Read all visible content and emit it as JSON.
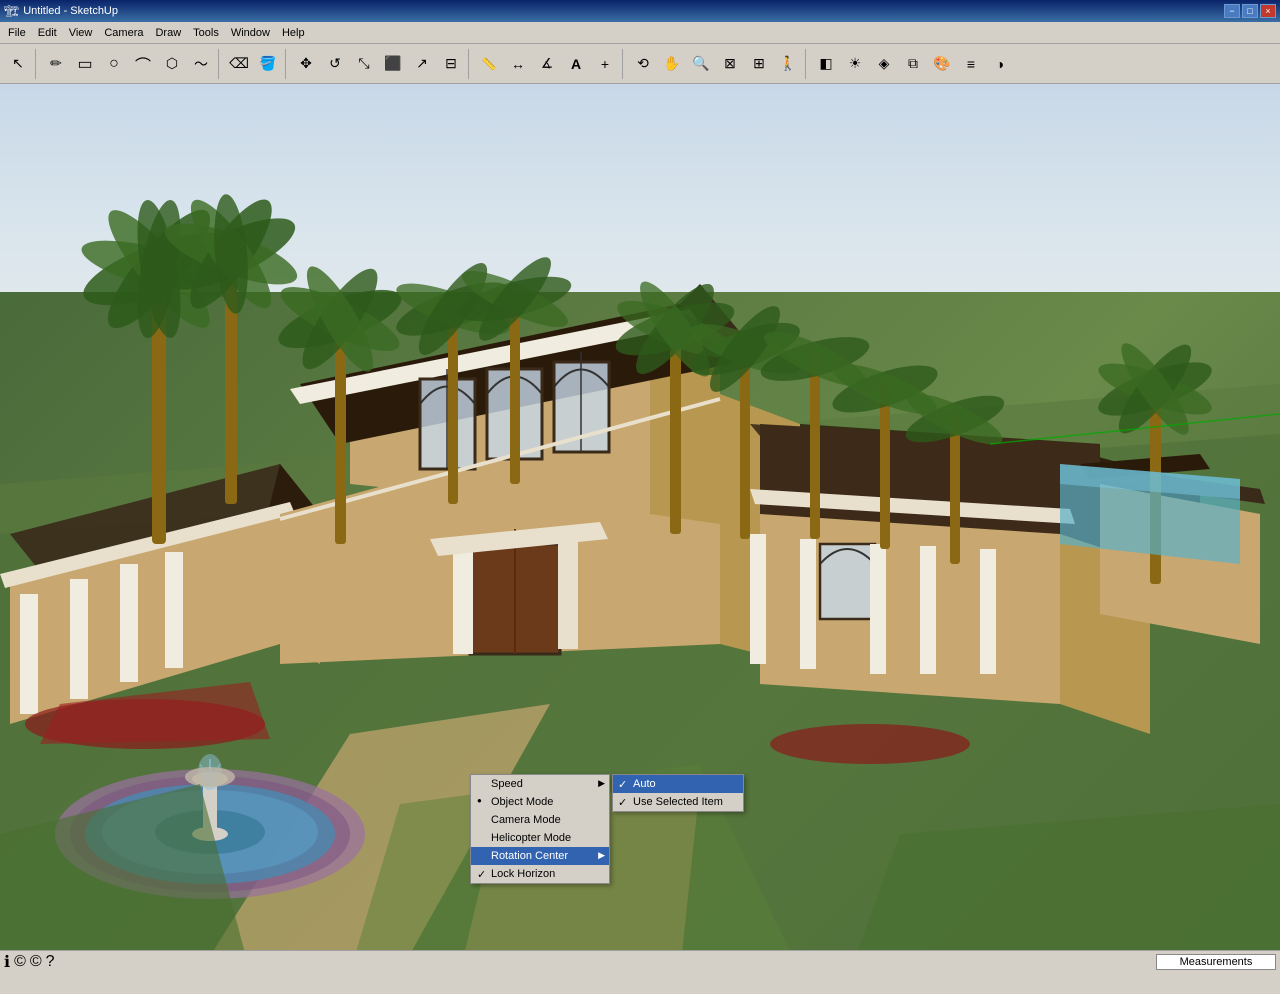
{
  "titlebar": {
    "title": "Untitled - SketchUp",
    "icon": "sketchup-icon",
    "controls": {
      "minimize": "−",
      "maximize": "□",
      "close": "×"
    }
  },
  "menubar": {
    "items": [
      "File",
      "Edit",
      "View",
      "Camera",
      "Draw",
      "Tools",
      "Window",
      "Help"
    ]
  },
  "toolbar": {
    "groups": [
      {
        "icons": [
          "arrow",
          "pencil",
          "rect",
          "circle",
          "arc",
          "poly"
        ]
      },
      {
        "icons": [
          "hand",
          "erase",
          "paint"
        ]
      },
      {
        "icons": [
          "move",
          "rotate",
          "scale",
          "push",
          "follow",
          "offset"
        ]
      },
      {
        "icons": [
          "tape",
          "dim",
          "proto",
          "text",
          "axis"
        ]
      },
      {
        "icons": [
          "orbit",
          "pan",
          "zoom",
          "zoomext",
          "zoomwin",
          "walk"
        ]
      },
      {
        "icons": [
          "section",
          "sun",
          "styles",
          "components",
          "materials",
          "layers",
          "shadows"
        ]
      }
    ]
  },
  "context_menu": {
    "items": [
      {
        "label": "Speed",
        "type": "arrow",
        "id": "speed"
      },
      {
        "label": "Object Mode",
        "type": "dot",
        "id": "object-mode"
      },
      {
        "label": "Camera Mode",
        "type": "plain",
        "id": "camera-mode"
      },
      {
        "label": "Helicopter Mode",
        "type": "plain",
        "id": "helicopter-mode"
      },
      {
        "label": "Rotation Center",
        "type": "arrow-highlighted",
        "id": "rotation-center"
      },
      {
        "label": "Lock Horizon",
        "type": "checkmark",
        "id": "lock-horizon"
      }
    ]
  },
  "submenu": {
    "items": [
      {
        "label": "Auto",
        "type": "checkmark-highlighted",
        "id": "auto"
      },
      {
        "label": "Use Selected Item",
        "type": "checkmark",
        "id": "use-selected"
      }
    ]
  },
  "statusbar": {
    "measurements_label": "Measurements"
  }
}
